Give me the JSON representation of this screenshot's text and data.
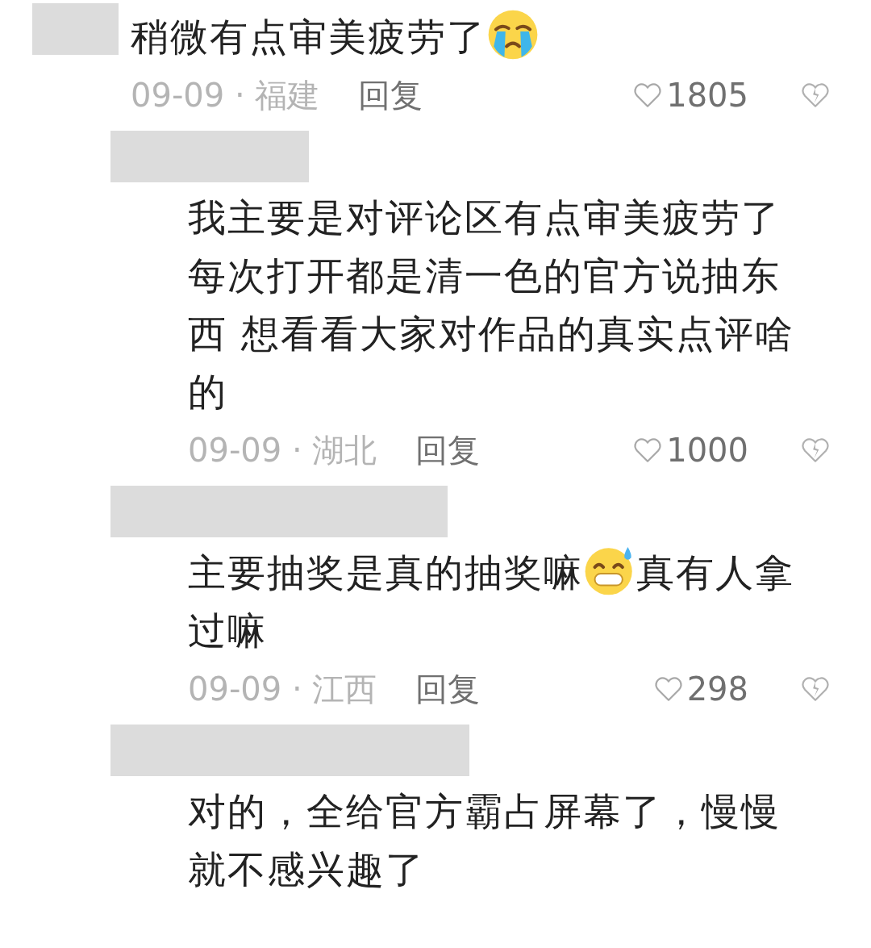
{
  "comments": [
    {
      "kind": "comment",
      "text": [
        {
          "kind": "text",
          "value": "稍微有点审美疲劳了"
        },
        {
          "kind": "crying-emoji"
        }
      ],
      "meta": "09-09 · 福建",
      "reply": "回复",
      "likes": "1805"
    },
    {
      "kind": "reply",
      "text": [
        {
          "kind": "text",
          "value": "我主要是对评论区有点审美疲劳了每次打开都是清一色的官方说抽东西 想看看大家对作品的真实点评啥的"
        }
      ],
      "meta": "09-09 · 湖北",
      "reply": "回复",
      "likes": "1000"
    },
    {
      "kind": "reply",
      "text": [
        {
          "kind": "text",
          "value": "主要抽奖是真的抽奖嘛"
        },
        {
          "kind": "sweat-grin-emoji"
        },
        {
          "kind": "text",
          "value": "真有人拿过嘛"
        }
      ],
      "meta": "09-09 · 江西",
      "reply": "回复",
      "likes": "298"
    },
    {
      "kind": "reply",
      "text": [
        {
          "kind": "text",
          "value": "对的，全给官方霸占屏幕了，慢慢就不感兴趣了"
        }
      ]
    }
  ]
}
